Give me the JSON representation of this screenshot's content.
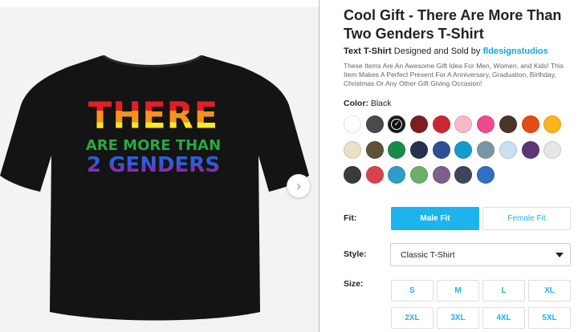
{
  "product": {
    "title": "Cool Gift - There Are More Than Two Genders T-Shirt",
    "type": "Text T-Shirt",
    "byline_middle": "Designed and Sold by",
    "artist": "fldesignstudios",
    "description": "These Items Are An Awesome Gift Idea For Men, Women, and Kids! This Item Makes A Perfect Present For A Anniversary, Graduation, Birthday, Christmas Or Any Other Gift Giving Occasion!"
  },
  "print": {
    "line1": "THERE",
    "line2": "ARE MORE THAN",
    "line3": "2 GENDERS"
  },
  "gallery": {
    "next_icon": "chevron-right-icon",
    "next_glyph": "›"
  },
  "color": {
    "label": "Color:",
    "selected": "Black",
    "swatches": [
      "#ffffff",
      "#4a4a4a",
      "#111111",
      "#7a1f24",
      "#c8282e",
      "#f7b8c8",
      "#ef4a8c",
      "#4a3428",
      "#e24e12",
      "#fbb41a",
      "#ebdfc4",
      "#5c5236",
      "#1a8a48",
      "#24324f",
      "#2e4f95",
      "#139bd0",
      "#7c95a4",
      "#c8e0f0",
      "#5d3479",
      "#e6e6e6",
      "#3a3a3c",
      "#d8424f",
      "#2f9ccc",
      "#6dae6a",
      "#7d5f8a",
      "#3c4658",
      "#2f6fc4"
    ],
    "selected_index": 2
  },
  "fit": {
    "label": "Fit:",
    "options": [
      "Male Fit",
      "Female Fit"
    ],
    "selected": "Male Fit"
  },
  "style": {
    "label": "Style:",
    "value": "Classic T-Shirt"
  },
  "size": {
    "label": "Size:",
    "options": [
      "S",
      "M",
      "L",
      "XL",
      "2XL",
      "3XL",
      "4XL",
      "5XL"
    ]
  },
  "colors": {
    "accent": "#1cb3ee",
    "shirt": "#141414"
  }
}
